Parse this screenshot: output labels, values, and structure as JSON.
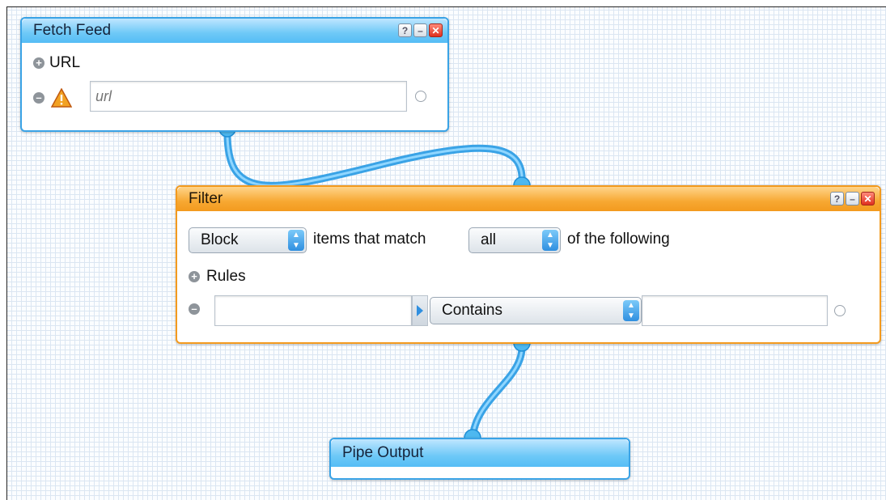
{
  "fetch_feed": {
    "title": "Fetch Feed",
    "url_section_label": "URL",
    "url_placeholder": "url",
    "controls": {
      "help": "?",
      "minimize": "–",
      "close": "✕"
    }
  },
  "filter": {
    "title": "Filter",
    "action_value": "Block",
    "items_text": "items that match",
    "match_value": "all",
    "following_text": "of the following",
    "rules_label": "Rules",
    "rule_operator": "Contains",
    "controls": {
      "help": "?",
      "minimize": "–",
      "close": "✕"
    }
  },
  "pipe_output": {
    "title": "Pipe Output"
  },
  "colors": {
    "blue_accent": "#3aa3e6",
    "orange_accent": "#f39a1e",
    "pipe": "#4db8f0"
  },
  "icons": [
    "plus-circle-icon",
    "minus-circle-icon",
    "warning-icon",
    "help-icon",
    "minimize-icon",
    "close-icon",
    "terminal-icon",
    "expand-arrow-icon"
  ]
}
